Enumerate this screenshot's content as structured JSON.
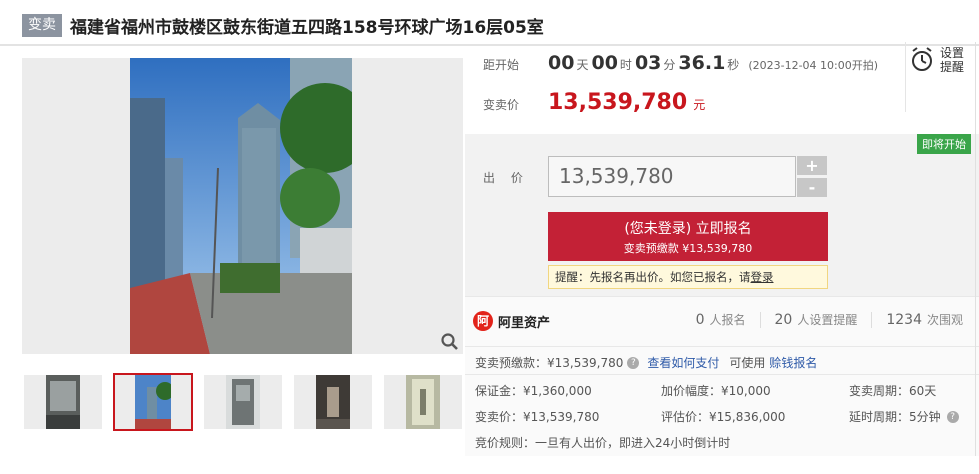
{
  "header": {
    "tag": "变卖",
    "title": "福建省福州市鼓楼区鼓东街道五四路158号环球广场16层05室"
  },
  "countdown": {
    "label": "距开始",
    "days": "00",
    "days_unit": "天",
    "hours": "00",
    "hours_unit": "时",
    "minutes": "03",
    "minutes_unit": "分",
    "seconds": "36.1",
    "seconds_unit": "秒",
    "start_note": "(2023-12-04 10:00开拍)"
  },
  "price": {
    "label": "变卖价",
    "value": "13,539,780",
    "unit": "元"
  },
  "reminder": {
    "label": "设置提醒",
    "icon": "alarm-clock-icon"
  },
  "bid": {
    "status_badge": "即将开始",
    "label": "出 价",
    "input_value": "13,539,780",
    "plus": "+",
    "minus": "-",
    "signup_main": "(您未登录) 立即报名",
    "signup_sub": "变卖预缴款 ¥13,539,780",
    "hint_text": "提醒：先报名再出价。如您已报名，请",
    "hint_link": "登录"
  },
  "platform": {
    "logo_text": "阿里资产",
    "stats": [
      {
        "num": "0",
        "label": "人报名"
      },
      {
        "num": "20",
        "label": "人设置提醒"
      },
      {
        "num": "1234",
        "label": "次围观"
      }
    ]
  },
  "details": {
    "deposit": "变卖预缴款：¥13,539,780",
    "how_to_pay": "查看如何支付",
    "usable_label": "可使用",
    "credit_signup": "赊钱报名",
    "guarantee": "保证金：¥1,360,000",
    "increment": "加价幅度：¥10,000",
    "period": "变卖周期：60天",
    "sale_price": "变卖价：¥13,539,780",
    "appraisal": "评估价：¥15,836,000",
    "extension": "延时周期：5分钟",
    "rule": "竞价规则：一旦有人出价，即进入24小时倒计时"
  },
  "colors": {
    "accent": "#c8161d",
    "button": "#c32136",
    "badge": "#3aa54a",
    "link": "#2e5aa8"
  },
  "gallery": {
    "thumb_count": 5,
    "active_index": 1
  }
}
